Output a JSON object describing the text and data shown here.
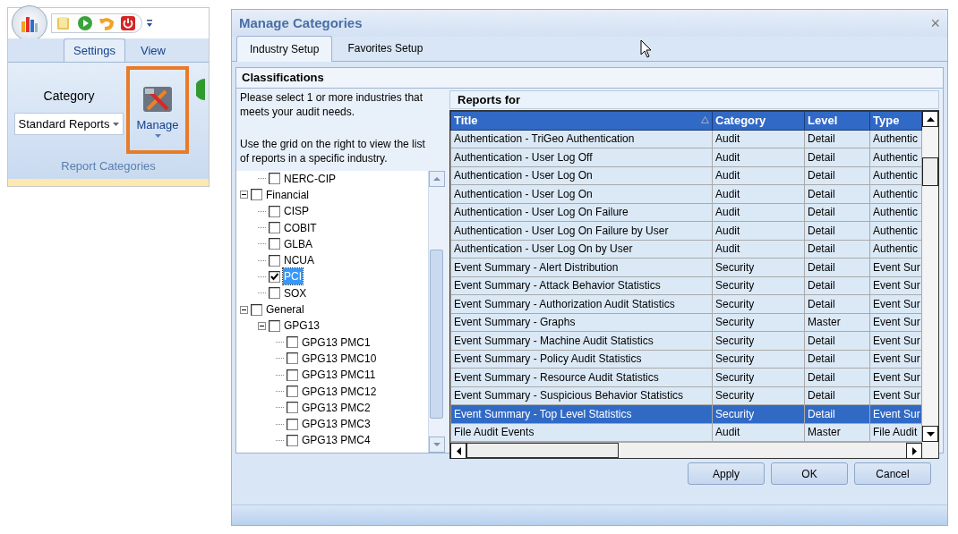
{
  "ribbon": {
    "tabs": [
      {
        "label": "Settings",
        "selected": true
      },
      {
        "label": "View",
        "selected": false
      }
    ],
    "group": {
      "field_label": "Category",
      "dropdown": {
        "value": "Standard Reports"
      },
      "manage_button": {
        "label": "Manage",
        "highlighted": true
      },
      "title": "Report Categories"
    }
  },
  "dialog": {
    "title": "Manage Categories",
    "close": "×",
    "tabs": [
      {
        "label": "Industry Setup",
        "selected": true
      },
      {
        "label": "Favorites Setup",
        "selected": false
      }
    ],
    "classifications": {
      "header": "Classifications",
      "instructions": [
        "Please select 1 or more industries that meets your audit needs.",
        "Use the grid on the right to view the list of reports in a specific industry."
      ],
      "tree": {
        "partial_branch": [
          {
            "label": "NERC-CIP",
            "checked": false,
            "selected": false
          }
        ],
        "nodes": [
          {
            "label": "Financial",
            "checked": false,
            "selected": false,
            "expanded": true,
            "children": [
              {
                "label": "CISP",
                "checked": false,
                "selected": false
              },
              {
                "label": "COBIT",
                "checked": false,
                "selected": false
              },
              {
                "label": "GLBA",
                "checked": false,
                "selected": false
              },
              {
                "label": "NCUA",
                "checked": false,
                "selected": false
              },
              {
                "label": "PCI",
                "checked": true,
                "selected": true
              },
              {
                "label": "SOX",
                "checked": false,
                "selected": false
              }
            ]
          },
          {
            "label": "General",
            "checked": false,
            "selected": false,
            "expanded": true,
            "children": [
              {
                "label": "GPG13",
                "checked": false,
                "selected": false,
                "expanded": true,
                "children": [
                  {
                    "label": "GPG13 PMC1",
                    "checked": false,
                    "selected": false
                  },
                  {
                    "label": "GPG13 PMC10",
                    "checked": false,
                    "selected": false
                  },
                  {
                    "label": "GPG13 PMC11",
                    "checked": false,
                    "selected": false
                  },
                  {
                    "label": "GPG13 PMC12",
                    "checked": false,
                    "selected": false
                  },
                  {
                    "label": "GPG13 PMC2",
                    "checked": false,
                    "selected": false
                  },
                  {
                    "label": "GPG13 PMC3",
                    "checked": false,
                    "selected": false
                  },
                  {
                    "label": "GPG13 PMC4",
                    "checked": false,
                    "selected": false
                  }
                ]
              }
            ]
          }
        ]
      }
    },
    "reports": {
      "header": "Reports for",
      "columns": [
        {
          "label": "Title",
          "sorted": true
        },
        {
          "label": "Category",
          "sorted": false
        },
        {
          "label": "Level",
          "sorted": false
        },
        {
          "label": "Type",
          "sorted": false
        }
      ],
      "rows": [
        {
          "cells": [
            "Authentication - TriGeo Authentication",
            "Audit",
            "Detail",
            "Authentic"
          ],
          "selected": false
        },
        {
          "cells": [
            "Authentication - User Log Off",
            "Audit",
            "Detail",
            "Authentic"
          ],
          "selected": false
        },
        {
          "cells": [
            "Authentication - User Log On",
            "Audit",
            "Detail",
            "Authentic"
          ],
          "selected": false
        },
        {
          "cells": [
            "Authentication - User Log On",
            "Audit",
            "Detail",
            "Authentic"
          ],
          "selected": false
        },
        {
          "cells": [
            "Authentication - User Log On Failure",
            "Audit",
            "Detail",
            "Authentic"
          ],
          "selected": false
        },
        {
          "cells": [
            "Authentication - User Log On Failure by User",
            "Audit",
            "Detail",
            "Authentic"
          ],
          "selected": false
        },
        {
          "cells": [
            "Authentication - User Log On by User",
            "Audit",
            "Detail",
            "Authentic"
          ],
          "selected": false
        },
        {
          "cells": [
            "Event Summary - Alert Distribution",
            "Security",
            "Detail",
            "Event Sur"
          ],
          "selected": false
        },
        {
          "cells": [
            "Event Summary - Attack Behavior Statistics",
            "Security",
            "Detail",
            "Event Sur"
          ],
          "selected": false
        },
        {
          "cells": [
            "Event Summary - Authorization Audit Statistics",
            "Security",
            "Detail",
            "Event Sur"
          ],
          "selected": false
        },
        {
          "cells": [
            "Event Summary - Graphs",
            "Security",
            "Master",
            "Event Sur"
          ],
          "selected": false
        },
        {
          "cells": [
            "Event Summary - Machine Audit Statistics",
            "Security",
            "Detail",
            "Event Sur"
          ],
          "selected": false
        },
        {
          "cells": [
            "Event Summary - Policy Audit Statistics",
            "Security",
            "Detail",
            "Event Sur"
          ],
          "selected": false
        },
        {
          "cells": [
            "Event Summary - Resource Audit Statistics",
            "Security",
            "Detail",
            "Event Sur"
          ],
          "selected": false
        },
        {
          "cells": [
            "Event Summary - Suspicious Behavior Statistics",
            "Security",
            "Detail",
            "Event Sur"
          ],
          "selected": false
        },
        {
          "cells": [
            "Event Summary - Top Level Statistics",
            "Security",
            "Detail",
            "Event Sur"
          ],
          "selected": true
        },
        {
          "cells": [
            "File Audit Events",
            "Audit",
            "Master",
            "File Audit"
          ],
          "selected": false
        }
      ]
    },
    "buttons": [
      "Apply",
      "OK",
      "Cancel"
    ]
  }
}
